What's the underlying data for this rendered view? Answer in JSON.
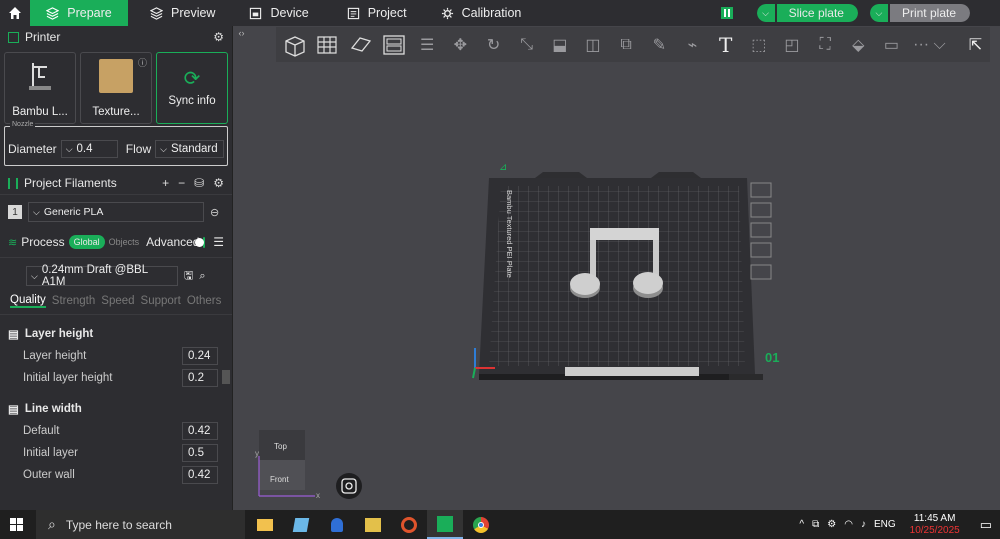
{
  "topbar": {
    "tabs": [
      {
        "label": "Prepare",
        "icon": "cube-layers-icon"
      },
      {
        "label": "Preview",
        "icon": "layers-icon"
      },
      {
        "label": "Device",
        "icon": "device-icon"
      },
      {
        "label": "Project",
        "icon": "project-icon"
      },
      {
        "label": "Calibration",
        "icon": "calibration-icon"
      }
    ],
    "slice_label": "Slice plate",
    "print_label": "Print plate",
    "accent": "#1aae59"
  },
  "printer": {
    "title": "Printer",
    "printer_name": "Bambu L...",
    "plate_name": "Texture...",
    "sync_label": "Sync info",
    "nozzle_legend": "Nozzle",
    "diameter_label": "Diameter",
    "diameter_value": "0.4",
    "flow_label": "Flow",
    "flow_value": "Standard"
  },
  "filaments": {
    "title": "Project Filaments",
    "items": [
      {
        "index": "1",
        "name": "Generic PLA"
      }
    ]
  },
  "process": {
    "title": "Process",
    "global_badge": "Global",
    "objects_label": "Objects",
    "advanced_label": "Advanced",
    "preset": "0.24mm Draft @BBL A1M",
    "tabs": [
      "Quality",
      "Strength",
      "Speed",
      "Support",
      "Others"
    ],
    "groups": [
      {
        "title": "Layer height",
        "rows": [
          {
            "label": "Layer height",
            "value": "0.24"
          },
          {
            "label": "Initial layer height",
            "value": "0.2"
          }
        ]
      },
      {
        "title": "Line width",
        "rows": [
          {
            "label": "Default",
            "value": "0.42"
          },
          {
            "label": "Initial layer",
            "value": "0.5"
          },
          {
            "label": "Outer wall",
            "value": "0.42"
          }
        ]
      }
    ]
  },
  "viewport": {
    "plate_text": "Bambu Textured PEI Plate",
    "plate_number": "01",
    "cube_top": "Top",
    "cube_front": "Front",
    "axis_y": "y",
    "axis_x": "x"
  },
  "taskbar": {
    "search_placeholder": "Type here to search",
    "lang": "ENG",
    "time": "11:45 AM",
    "date": "10/25/2025"
  }
}
